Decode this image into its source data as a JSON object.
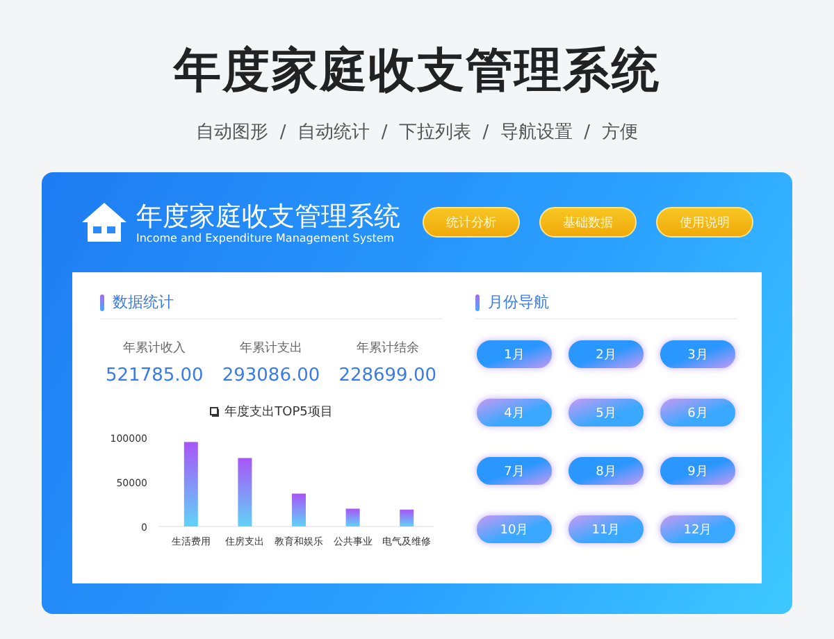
{
  "page_title": "年度家庭收支管理系统",
  "features": "自动图形  /  自动统计  /  下拉列表  /  导航设置  /  方便",
  "app": {
    "title": "年度家庭收支管理系统",
    "subtitle": "Income and Expenditure Management System",
    "nav_buttons": [
      "统计分析",
      "基础数据",
      "使用说明"
    ]
  },
  "stats_panel": {
    "heading": "数据统计",
    "stats": [
      {
        "label": "年累计收入",
        "value": "521785.00"
      },
      {
        "label": "年累计支出",
        "value": "293086.00"
      },
      {
        "label": "年累计结余",
        "value": "228699.00"
      }
    ],
    "chart_data": {
      "type": "bar",
      "title": "年度支出TOP5项目",
      "categories": [
        "生活费用",
        "住房支出",
        "教育和娱乐",
        "公共事业",
        "电气及维修"
      ],
      "values": [
        95000,
        77000,
        37000,
        20000,
        19000
      ],
      "ylim": [
        0,
        100000
      ],
      "yticks": [
        0,
        50000,
        100000
      ]
    }
  },
  "month_panel": {
    "heading": "月份导航",
    "months": [
      "1月",
      "2月",
      "3月",
      "4月",
      "5月",
      "6月",
      "7月",
      "8月",
      "9月",
      "10月",
      "11月",
      "12月"
    ]
  }
}
